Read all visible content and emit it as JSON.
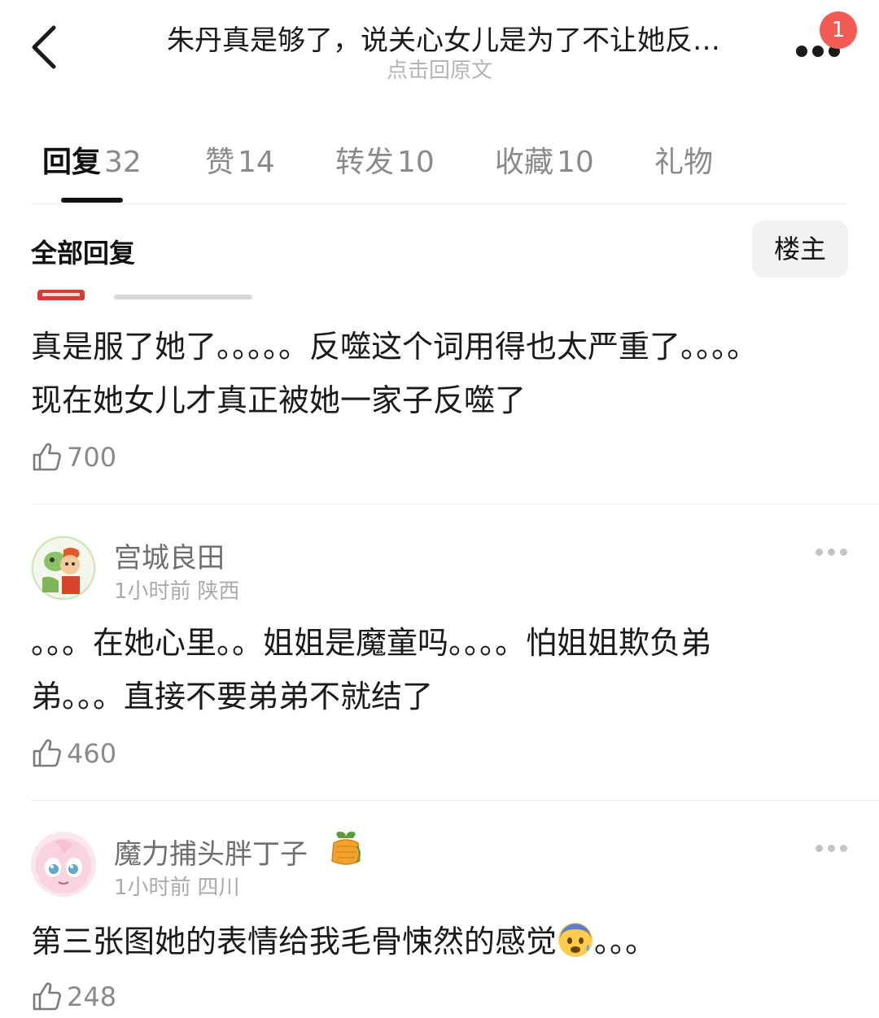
{
  "header": {
    "title": "朱丹真是够了，说关心女儿是为了不让她反…",
    "subtitle": "点击回原文",
    "notification_count": "1"
  },
  "tabs": [
    {
      "label": "回复",
      "count": "32",
      "active": true
    },
    {
      "label": "赞",
      "count": "14",
      "active": false
    },
    {
      "label": "转发",
      "count": "10",
      "active": false
    },
    {
      "label": "收藏",
      "count": "10",
      "active": false
    },
    {
      "label": "礼物",
      "count": "",
      "active": false
    }
  ],
  "section": {
    "title": "全部回复",
    "filter_button": "楼主"
  },
  "comments": [
    {
      "text_line1": "真是服了她了。。。。。反噬这个词用得也太严重了。。。。",
      "text_line2": "现在她女儿才真正被她一家子反噬了",
      "likes": "700"
    },
    {
      "username": "宫城良田",
      "time": "1小时前",
      "location": "陕西",
      "text_line1": "。。。在她心里。。姐姐是魔童吗。。。。怕姐姐欺负弟",
      "text_line2": "弟。。。直接不要弟弟不就结了",
      "likes": "460"
    },
    {
      "username": "魔力捕头胖丁子",
      "time": "1小时前",
      "location": "四川",
      "text": "第三张图她的表情给我毛骨悚然的感觉",
      "text_suffix": "。。。",
      "emoji": "fearful-face",
      "likes": "248"
    }
  ],
  "icons": {
    "back": "chevron-left-icon",
    "more": "more-icon",
    "like": "thumbs-up-icon",
    "medal": "lucky-bag-medal-icon"
  },
  "colors": {
    "badge": "#f25c54",
    "muted": "#8a8a8a",
    "text": "#1a1a1a"
  }
}
